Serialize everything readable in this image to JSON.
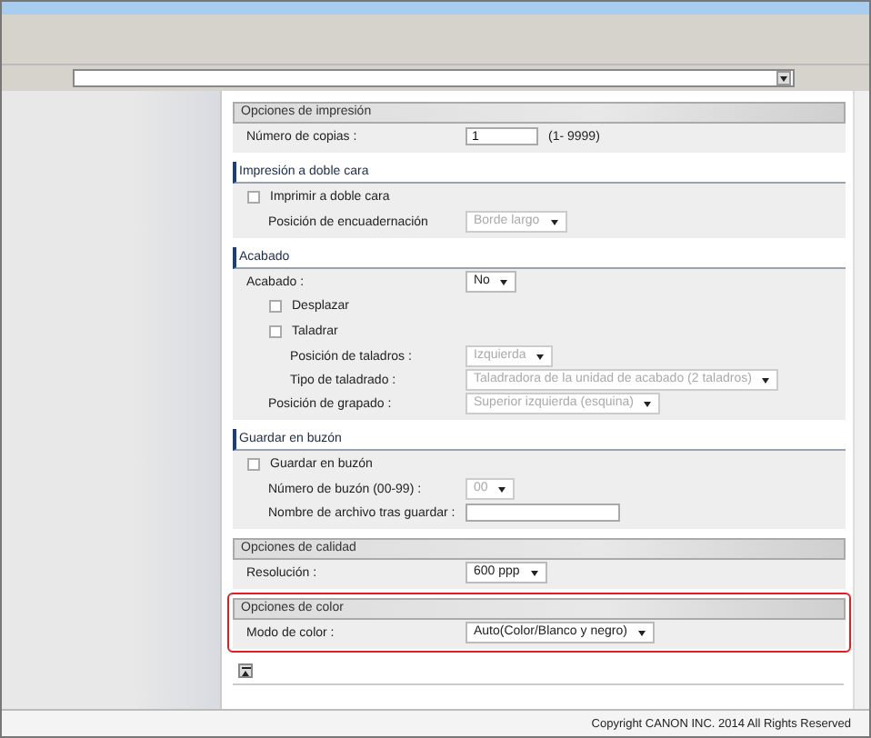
{
  "sections": [
    {
      "title": "Opciones de impresión",
      "kind": "options",
      "highlighted": false,
      "rows": [
        {
          "kind": "field",
          "label": "Número de copias :",
          "value": "1",
          "hint": "(1- 9999)",
          "disabled": false
        }
      ]
    },
    {
      "title": "Impresión a doble cara",
      "kind": "subsection",
      "highlighted": false,
      "rows": [
        {
          "kind": "checkbox",
          "label": "Imprimir a doble cara",
          "checked": false,
          "children": [
            {
              "kind": "select",
              "label": "Posición de encuadernación",
              "value": "Borde largo",
              "disabled": true
            }
          ]
        }
      ]
    },
    {
      "title": "Acabado",
      "kind": "subsection",
      "highlighted": false,
      "rows": [
        {
          "kind": "select",
          "label": "Acabado :",
          "value": "No",
          "disabled": false,
          "children": [
            {
              "kind": "checkbox",
              "label": "Desplazar",
              "checked": false
            },
            {
              "kind": "checkbox",
              "label": "Taladrar",
              "checked": false,
              "children": [
                {
                  "kind": "select",
                  "label": "Posición de taladros :",
                  "value": "Izquierda",
                  "disabled": true
                },
                {
                  "kind": "select",
                  "label": "Tipo de taladrado :",
                  "value": "Taladradora de la unidad de acabado (2 taladros)",
                  "disabled": true
                }
              ]
            },
            {
              "kind": "select",
              "label": "Posición de grapado :",
              "value": "Superior izquierda (esquina)",
              "disabled": true
            }
          ]
        }
      ]
    },
    {
      "title": "Guardar en buzón",
      "kind": "subsection",
      "highlighted": false,
      "rows": [
        {
          "kind": "checkbox",
          "label": "Guardar en buzón",
          "checked": false,
          "children": [
            {
              "kind": "select",
              "label": "Número de buzón (00-99) :",
              "value": "00",
              "disabled": true
            },
            {
              "kind": "field",
              "label": "Nombre de archivo tras guardar :",
              "disabled": false
            }
          ]
        }
      ]
    },
    {
      "title": "Opciones de calidad",
      "kind": "options",
      "highlighted": false,
      "rows": [
        {
          "kind": "select",
          "label": "Resolución :",
          "value": "600 ppp",
          "disabled": false
        }
      ]
    },
    {
      "title": "Opciones de color",
      "kind": "options",
      "highlighted": true,
      "rows": [
        {
          "kind": "select",
          "label": "Modo de color :",
          "value": "Auto(Color/Blanco y negro)",
          "disabled": false
        }
      ]
    }
  ],
  "footer": {
    "copyright": "Copyright CANON INC. 2014 All Rights Reserved"
  }
}
